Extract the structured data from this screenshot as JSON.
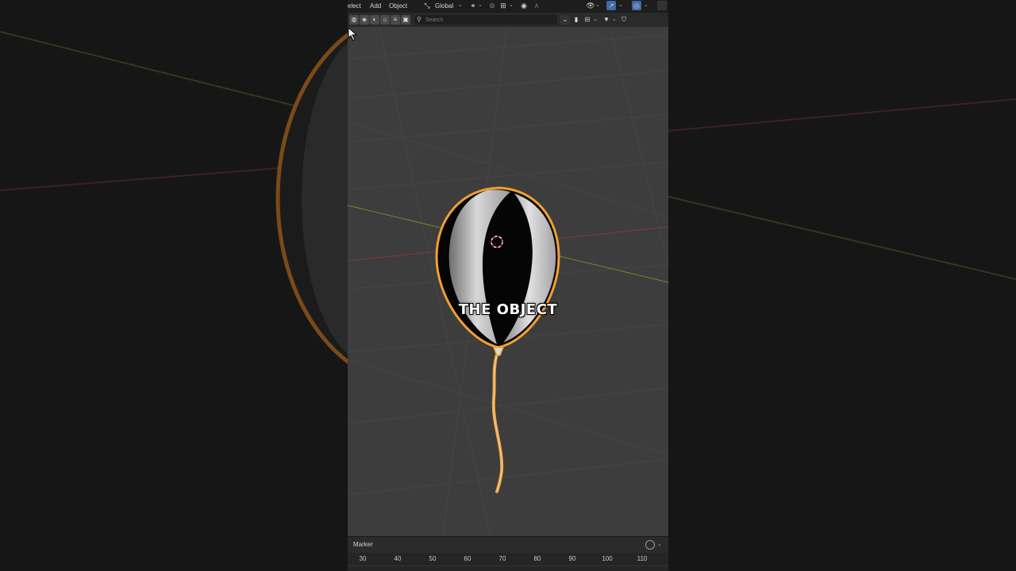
{
  "header": {
    "menus": [
      "elect",
      "Add",
      "Object"
    ],
    "transform_orientation": "Global"
  },
  "toolbar": {
    "search_placeholder": "Search"
  },
  "viewport": {
    "subtitle": "THE OBJECT",
    "selection_color": "#f0a030",
    "x_axis_color": "#b03a3a",
    "y_axis_color": "#6a8f2a"
  },
  "timeline": {
    "label": "Marker",
    "frame_ticks": [
      "30",
      "40",
      "50",
      "60",
      "70",
      "80",
      "90",
      "100",
      "110"
    ]
  },
  "icons": [
    "select-cursor-icon",
    "transform-orientation-icon",
    "snap-icon",
    "proportional-edit-icon",
    "visibility-icon",
    "gizmo-icon",
    "overlay-icon",
    "search-icon",
    "filter-icon",
    "bookmark-icon",
    "shield-icon",
    "marker-toggle-icon"
  ]
}
